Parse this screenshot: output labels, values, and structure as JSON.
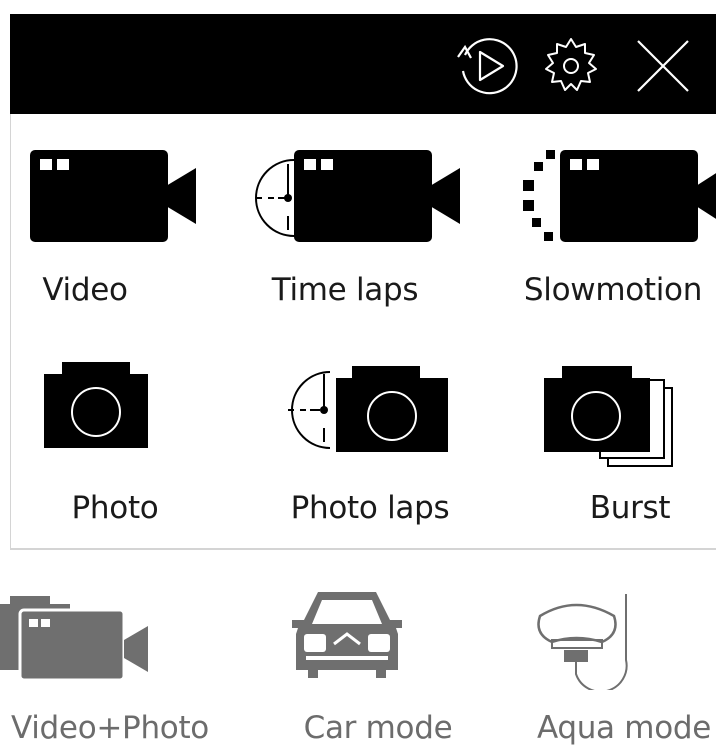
{
  "toolbar": {
    "icons": [
      "playback-icon",
      "settings-gear-icon",
      "close-icon"
    ]
  },
  "modes": [
    {
      "label": "Video",
      "icon": "video-camera-icon"
    },
    {
      "label": "Time laps",
      "icon": "timelapse-camera-icon"
    },
    {
      "label": "Slowmotion",
      "icon": "slowmotion-camera-icon"
    },
    {
      "label": "Photo",
      "icon": "photo-camera-icon"
    },
    {
      "label": "Photo laps",
      "icon": "photo-timelapse-icon"
    },
    {
      "label": "Burst",
      "icon": "burst-photo-icon"
    }
  ],
  "other_modes": [
    {
      "label": "Video+Photo",
      "icon": "video-photo-icon"
    },
    {
      "label": "Car mode",
      "icon": "car-icon"
    },
    {
      "label": "Aqua mode",
      "icon": "diving-mask-icon"
    }
  ],
  "colors": {
    "bar": "#000000",
    "icon_active": "#000000",
    "icon_inactive": "#6f6f6f"
  }
}
